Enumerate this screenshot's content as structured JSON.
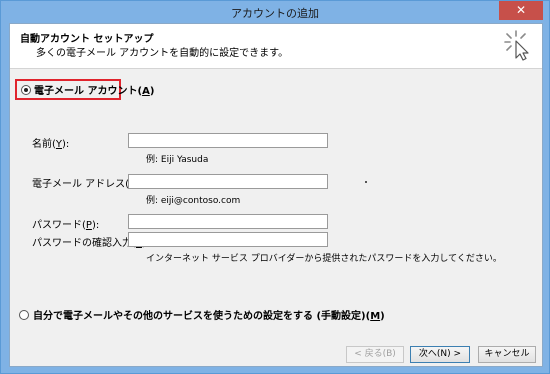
{
  "window": {
    "title": "アカウントの追加",
    "close_glyph": "✕"
  },
  "header": {
    "title": "自動アカウント セットアップ",
    "subtitle": "多くの電子メール アカウントを自動的に設定できます。",
    "icon": "wizard-cursor-icon"
  },
  "email_option": {
    "label": "電子メール アカウント(",
    "accel": "A",
    "label_end": ")",
    "selected": true
  },
  "fields": {
    "name": {
      "label": "名前(",
      "accel": "Y",
      "label_end": "):",
      "value": "",
      "example": "例: Eiji Yasuda"
    },
    "email": {
      "label": "電子メール アドレス(",
      "accel": "E",
      "label_end": "):",
      "value": "",
      "example": "例: eiji@contoso.com"
    },
    "password": {
      "label": "パスワード(",
      "accel": "P",
      "label_end": "):",
      "value": ""
    },
    "password_confirm": {
      "label": "パスワードの確認入力(",
      "accel": "T",
      "label_end": "):",
      "value": "",
      "hint": "インターネット サービス プロバイダーから提供されたパスワードを入力してください。"
    }
  },
  "manual_option": {
    "label": "自分で電子メールやその他のサービスを使うための設定をする (手動設定)(",
    "accel": "M",
    "label_end": ")",
    "selected": false
  },
  "buttons": {
    "back": "< 戻る(B)",
    "next": "次へ(N) >",
    "cancel": "キャンセル"
  },
  "colors": {
    "titlebar": "#7fb2e5",
    "close_button": "#c7504a",
    "highlight_border": "#e0242d",
    "dialog_background": "#f0f0f0"
  }
}
